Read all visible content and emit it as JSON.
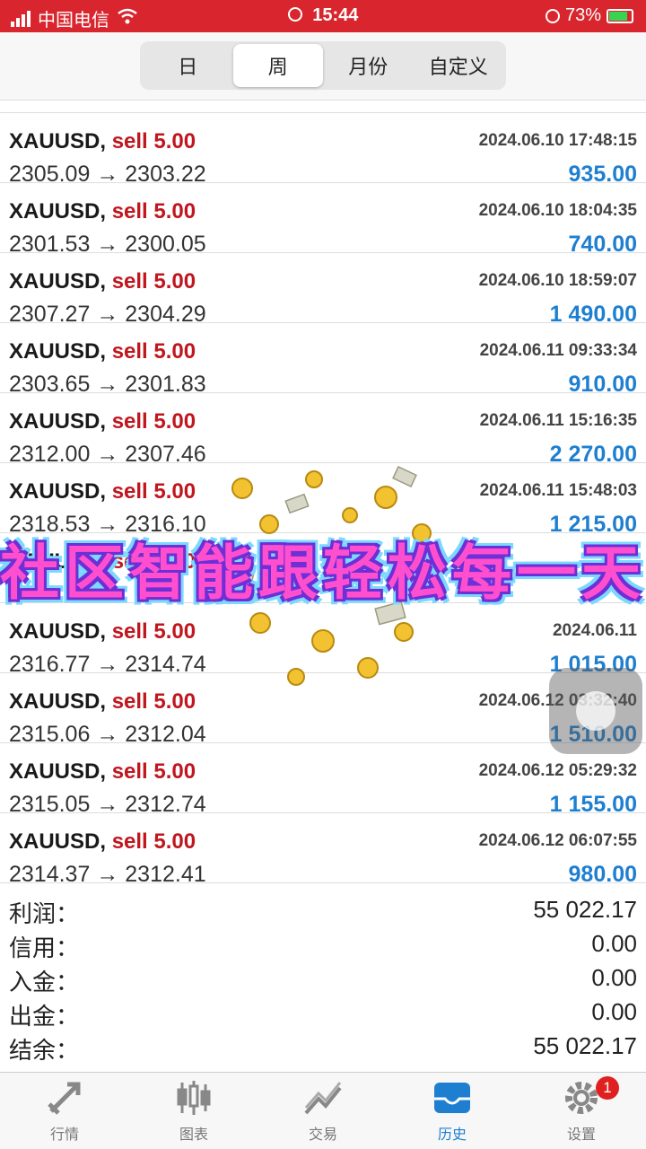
{
  "status_bar": {
    "carrier": "中国电信",
    "time": "15:44",
    "battery": "73%"
  },
  "period_tabs": [
    "日",
    "周",
    "月份",
    "自定义"
  ],
  "active_tab": "周",
  "trades": [
    {
      "symbol": "XAUUSD,",
      "side": "sell 5.00",
      "time": "2024.06.10 17:48:15",
      "prices": "2305.09 → 2303.22",
      "profit": "935.00"
    },
    {
      "symbol": "XAUUSD,",
      "side": "sell 5.00",
      "time": "2024.06.10 18:04:35",
      "prices": "2301.53 → 2300.05",
      "profit": "740.00"
    },
    {
      "symbol": "XAUUSD,",
      "side": "sell 5.00",
      "time": "2024.06.10 18:59:07",
      "prices": "2307.27 → 2304.29",
      "profit": "1 490.00"
    },
    {
      "symbol": "XAUUSD,",
      "side": "sell 5.00",
      "time": "2024.06.11 09:33:34",
      "prices": "2303.65 → 2301.83",
      "profit": "910.00"
    },
    {
      "symbol": "XAUUSD,",
      "side": "sell 5.00",
      "time": "2024.06.11 15:16:35",
      "prices": "2312.00 → 2307.46",
      "profit": "2 270.00"
    },
    {
      "symbol": "XAUUSD,",
      "side": "sell 5.00",
      "time": "2024.06.11 15:48:03",
      "prices": "2318.53 → 2316.10",
      "profit": "1 215.00"
    },
    {
      "symbol": "XAUUSD,",
      "side": "sell 5.00",
      "time": "",
      "prices": "",
      "profit": ""
    },
    {
      "symbol": "XAUUSD,",
      "side": "sell 5.00",
      "time": "2024.06.11",
      "prices": "2316.77 → 2314.74",
      "profit": "1 015.00"
    },
    {
      "symbol": "XAUUSD,",
      "side": "sell 5.00",
      "time": "2024.06.12 03:32:40",
      "prices": "2315.06 → 2312.04",
      "profit": "1 510.00"
    },
    {
      "symbol": "XAUUSD,",
      "side": "sell 5.00",
      "time": "2024.06.12 05:29:32",
      "prices": "2315.05 → 2312.74",
      "profit": "1 155.00"
    },
    {
      "symbol": "XAUUSD,",
      "side": "sell 5.00",
      "time": "2024.06.12 06:07:55",
      "prices": "2314.37 → 2312.41",
      "profit": "980.00"
    }
  ],
  "summary": [
    {
      "label": "利润：",
      "value": "55 022.17"
    },
    {
      "label": "信用：",
      "value": "0.00"
    },
    {
      "label": "入金：",
      "value": "0.00"
    },
    {
      "label": "出金：",
      "value": "0.00"
    },
    {
      "label": "结余：",
      "value": "55 022.17"
    }
  ],
  "overlay_banner": "社区智能跟轻松每一天",
  "bottom_tabs": [
    "行情",
    "图表",
    "交易",
    "历史",
    "设置"
  ],
  "settings_badge": "1",
  "colors": {
    "status_bar": "#d9262e",
    "sell": "#c0161e",
    "profit": "#1e7fd0",
    "banner": "#ff4fcf"
  }
}
